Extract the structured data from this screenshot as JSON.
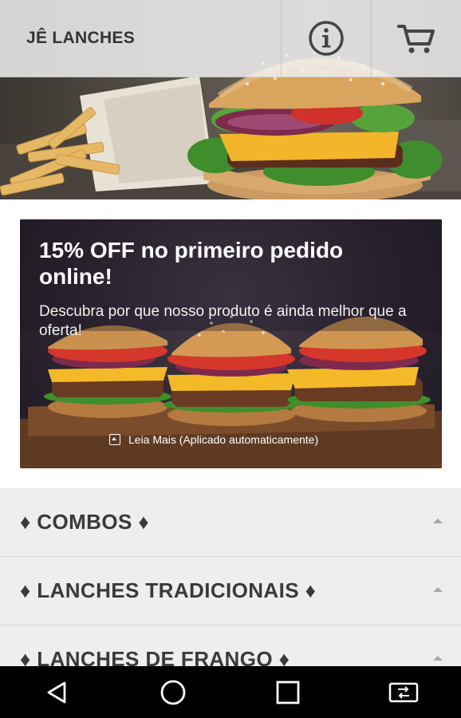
{
  "app": {
    "title": "JÊ LANCHES"
  },
  "topbar": {
    "info_icon": "info-icon",
    "cart_icon": "cart-icon"
  },
  "promo": {
    "title": "15% OFF no primeiro pedido online!",
    "subtitle": "Descubra por que nosso produto é ainda melhor que a oferta!",
    "more_label": "Leia Mais (Aplicado automaticamente)"
  },
  "categories": [
    {
      "label": "♦ COMBOS ♦"
    },
    {
      "label": "♦ LANCHES TRADICIONAIS ♦"
    },
    {
      "label": "♦ LANCHES DE FRANGO ♦"
    }
  ],
  "navbar": {
    "icons": [
      "back-icon",
      "home-icon",
      "recents-icon",
      "screen-rotate-icon"
    ]
  },
  "colors": {
    "topbar_bg": "#f0f0f0",
    "category_bg": "#eeeeee",
    "category_text": "#3a3a3a",
    "nav_bg": "#000000"
  }
}
